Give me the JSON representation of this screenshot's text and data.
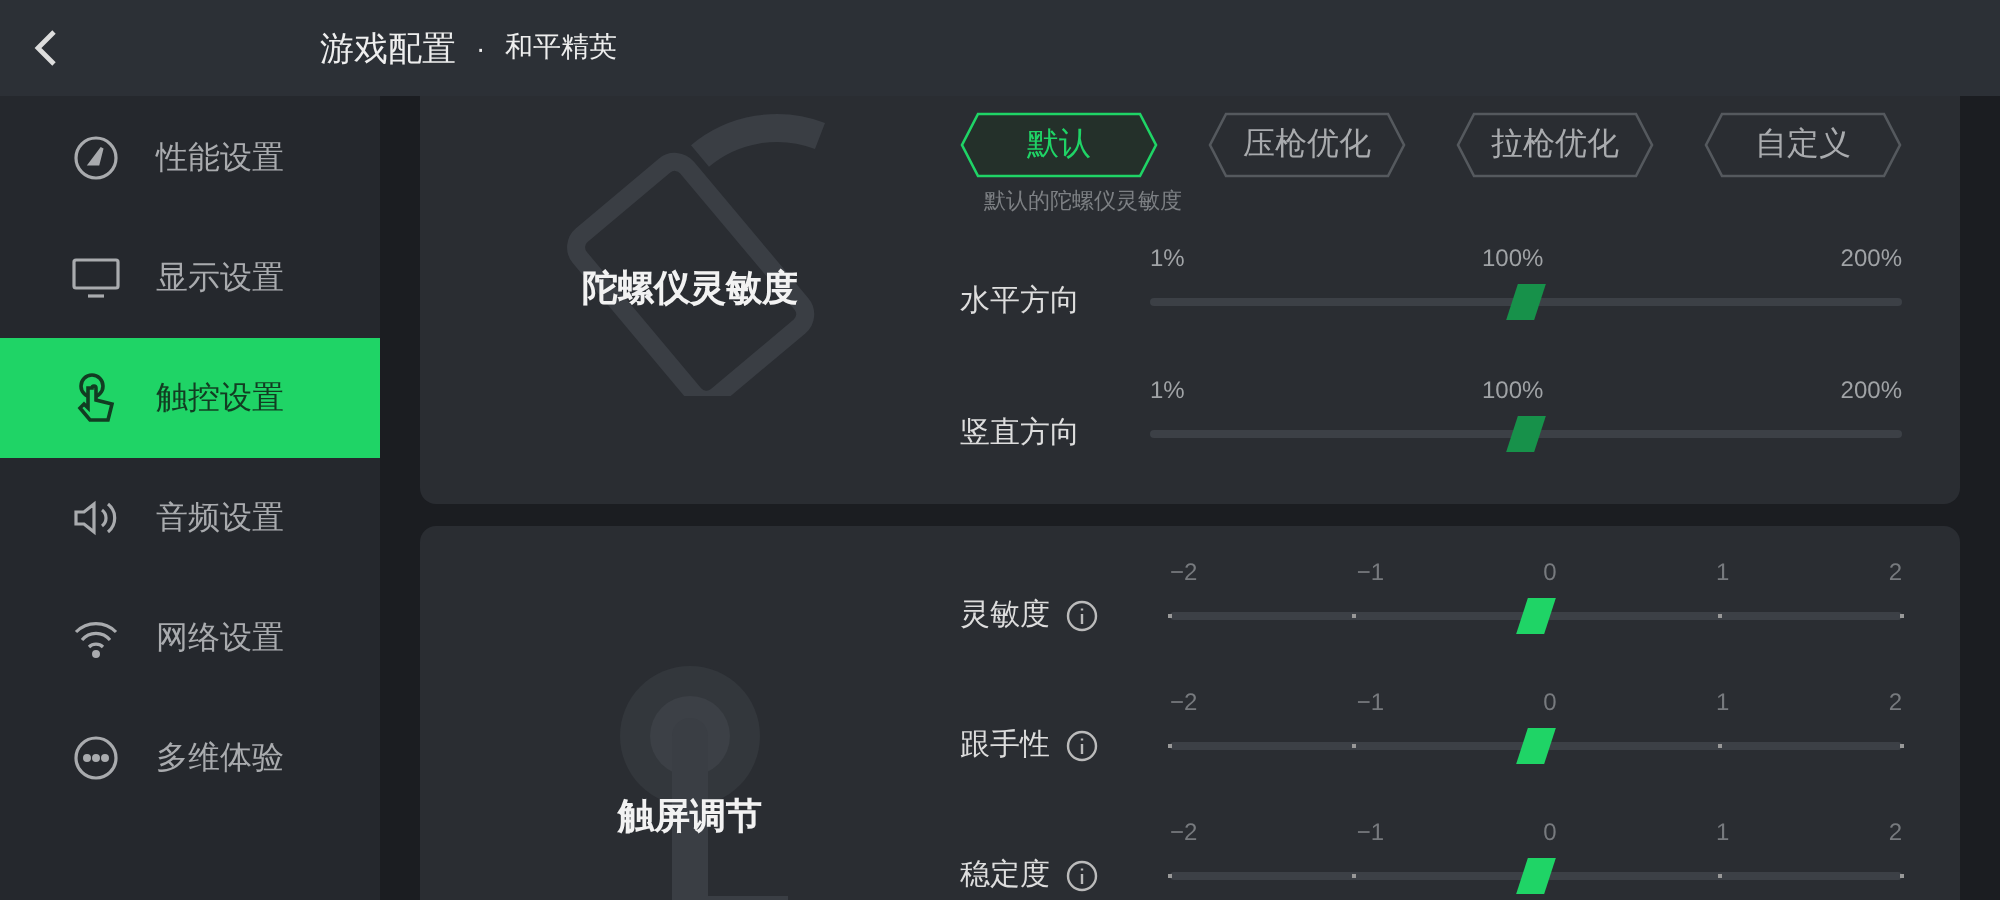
{
  "header": {
    "title": "游戏配置",
    "separator": "·",
    "subtitle": "和平精英"
  },
  "sidebar": {
    "items": [
      {
        "label": "性能设置",
        "kind": "performance",
        "selected": false
      },
      {
        "label": "显示设置",
        "kind": "display",
        "selected": false
      },
      {
        "label": "触控设置",
        "kind": "touch",
        "selected": true
      },
      {
        "label": "音频设置",
        "kind": "audio",
        "selected": false
      },
      {
        "label": "网络设置",
        "kind": "network",
        "selected": false
      },
      {
        "label": "多维体验",
        "kind": "more",
        "selected": false
      }
    ]
  },
  "cards": [
    {
      "title": "陀螺仪灵敏度",
      "kind": "gyro",
      "presets": [
        {
          "label": "默认",
          "selected": true
        },
        {
          "label": "压枪优化",
          "selected": false
        },
        {
          "label": "拉枪优化",
          "selected": false
        },
        {
          "label": "自定义",
          "selected": false
        }
      ],
      "preset_hint": "默认的陀螺仪灵敏度",
      "sliders": [
        {
          "label": "水平方向",
          "info": false,
          "tick_marks": false,
          "ticks": [
            "1%",
            "100%",
            "200%"
          ],
          "level": 0.5
        },
        {
          "label": "竖直方向",
          "info": false,
          "tick_marks": false,
          "ticks": [
            "1%",
            "100%",
            "200%"
          ],
          "level": 0.5
        }
      ]
    },
    {
      "title": "触屏调节",
      "kind": "touch",
      "sliders": [
        {
          "label": "灵敏度",
          "info": true,
          "tick_marks": true,
          "ticks": [
            "−2",
            "−1",
            "0",
            "1",
            "2"
          ],
          "level": 0.5
        },
        {
          "label": "跟手性",
          "info": true,
          "tick_marks": true,
          "ticks": [
            "−2",
            "−1",
            "0",
            "1",
            "2"
          ],
          "level": 0.5
        },
        {
          "label": "稳定度",
          "info": true,
          "tick_marks": true,
          "ticks": [
            "−2",
            "−1",
            "0",
            "1",
            "2"
          ],
          "level": 0.5
        }
      ]
    }
  ]
}
